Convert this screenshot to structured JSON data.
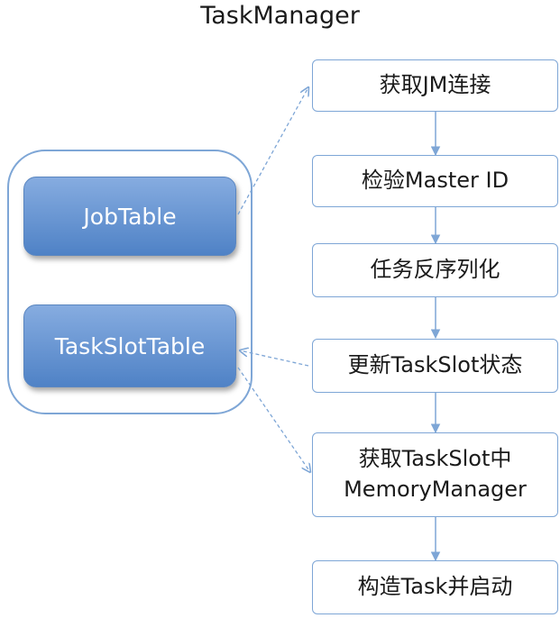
{
  "title": "TaskManager",
  "components": {
    "job_table": "JobTable",
    "task_slot_table": "TaskSlotTable"
  },
  "steps": [
    {
      "label": "获取JM连接"
    },
    {
      "label": "检验Master ID"
    },
    {
      "label": "任务反序列化"
    },
    {
      "label": "更新TaskSlot状态"
    },
    {
      "label": "获取TaskSlot中\nMemoryManager"
    },
    {
      "label": "构造Task并启动"
    }
  ],
  "colors": {
    "accent": "#7ea6d6",
    "component_top": "#86ace0",
    "component_bottom": "#4f82c6"
  }
}
